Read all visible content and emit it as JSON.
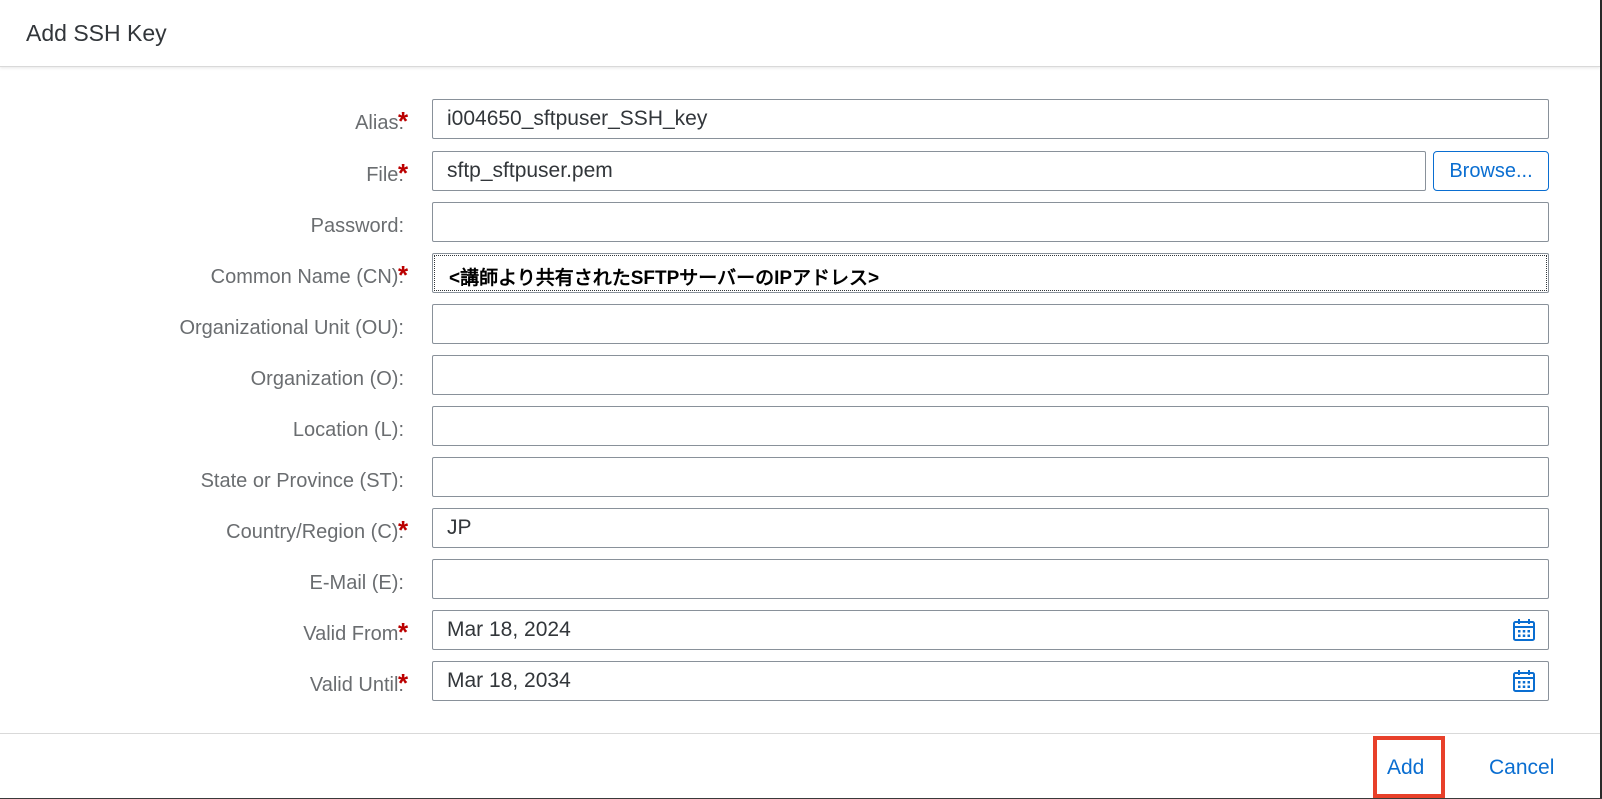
{
  "dialog": {
    "title": "Add SSH Key"
  },
  "form": {
    "alias": {
      "label": "Alias:",
      "value": "i004650_sftpuser_SSH_key",
      "required": true
    },
    "file": {
      "label": "File:",
      "value": "sftp_sftpuser.pem",
      "required": true,
      "browse_label": "Browse..."
    },
    "password": {
      "label": "Password:",
      "value": "",
      "required": false
    },
    "common_name": {
      "label": "Common Name (CN):",
      "value": "<講師より共有されたSFTPサーバーのIPアドレス>",
      "required": true
    },
    "org_unit": {
      "label": "Organizational Unit (OU):",
      "value": "",
      "required": false
    },
    "organization": {
      "label": "Organization (O):",
      "value": "",
      "required": false
    },
    "location": {
      "label": "Location (L):",
      "value": "",
      "required": false
    },
    "state": {
      "label": "State or Province (ST):",
      "value": "",
      "required": false
    },
    "country": {
      "label": "Country/Region (C):",
      "value": "JP",
      "required": true
    },
    "email": {
      "label": "E-Mail (E):",
      "value": "",
      "required": false
    },
    "valid_from": {
      "label": "Valid From:",
      "value": "Mar 18, 2024",
      "required": true
    },
    "valid_until": {
      "label": "Valid Until:",
      "value": "Mar 18, 2034",
      "required": true
    },
    "required_marker": "*"
  },
  "footer": {
    "add_label": "Add",
    "cancel_label": "Cancel"
  },
  "colors": {
    "accent": "#0a6ed1",
    "required": "#bb0000",
    "highlight": "#e8402a"
  },
  "icons": {
    "calendar": "calendar-icon"
  }
}
